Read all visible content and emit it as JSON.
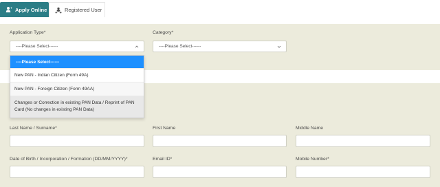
{
  "tabs": [
    {
      "label": "Apply Online",
      "icon": "user-plus-icon",
      "active": true
    },
    {
      "label": "Registered User",
      "icon": "user-network-icon",
      "active": false
    }
  ],
  "form": {
    "application_type_label": "Application Type*",
    "application_type_value": "----Please Select------",
    "category_label": "Category*",
    "category_value": "----Please Select------",
    "last_name_label": "Last Name / Surname*",
    "first_name_label": "First Name",
    "middle_name_label": "Middle Name",
    "dob_label": "Date of Birth / Incorporation / Formation (DD/MM/YYYY)*",
    "email_label": "Email ID*",
    "mobile_label": "Mobile Number*"
  },
  "dropdown": {
    "options": [
      "----Please Select------",
      "New PAN - Indian Citizen (Form 49A)",
      "New PAN - Foreign Citizen (Form 49AA)",
      "Changes or Correction in existing PAN Data / Reprint of PAN Card (No changes in existing PAN Data)"
    ]
  },
  "colors": {
    "accent": "#2b7d86",
    "panel": "#ecebdc",
    "selected_option": "#1e90ff"
  }
}
